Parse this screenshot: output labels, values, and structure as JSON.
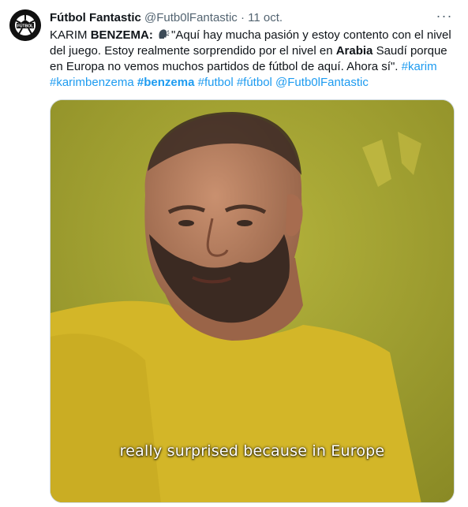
{
  "tweet": {
    "author_name": "Fútbol Fantastic",
    "handle": "@Futb0lFantastic",
    "separator": "·",
    "date": "11 oct.",
    "avatar_text": "FÚTBOL",
    "more_icon": "more-horizontal-icon",
    "body": {
      "lead": "KARIM ",
      "lead_bold": "BENZEMA:",
      "emoji_icon": "speaking-head-icon",
      "quote_part1": "\"Aquí hay mucha pasión y estoy contento con el nivel del juego. Estoy realmente sorprendido por el nivel en ",
      "quote_bold": "Arabia",
      "quote_part2": " Saudí porque en Europa no vemos muchos partidos de fútbol de aquí. Ahora sí\".",
      "hashtag_1": "#karim",
      "hashtag_2": "#karimbenzema",
      "hashtag_3": "#benzema",
      "hashtag_4": "#futbol",
      "hashtag_5": "#fútbol",
      "mention": "@Futb0lFantastic"
    },
    "media": {
      "subtitle": "really surprised because in Europe",
      "background_color": "#9b9b2b",
      "shirt_color": "#d4b82a"
    }
  }
}
